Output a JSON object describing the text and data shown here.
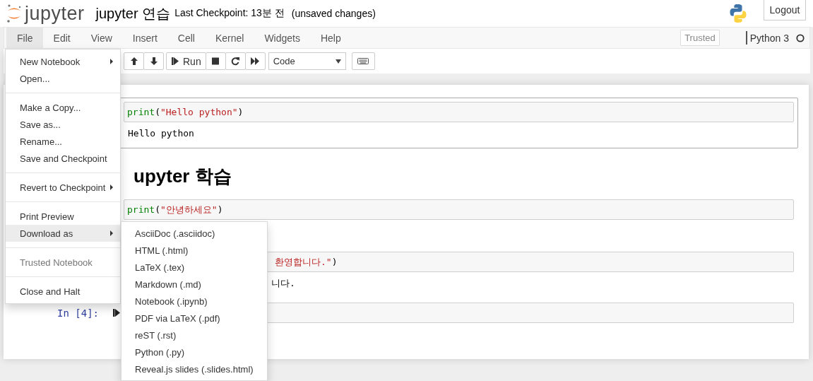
{
  "header": {
    "logo_text": "jupyter",
    "notebook_name": "jupyter 연습",
    "last_checkpoint": "Last Checkpoint: 13분 전",
    "autosave_status": "(unsaved changes)",
    "logout": "Logout"
  },
  "menubar": {
    "items": [
      {
        "label": "File",
        "selected": true
      },
      {
        "label": "Edit",
        "selected": false
      },
      {
        "label": "View",
        "selected": false
      },
      {
        "label": "Insert",
        "selected": false
      },
      {
        "label": "Cell",
        "selected": false
      },
      {
        "label": "Kernel",
        "selected": false
      },
      {
        "label": "Widgets",
        "selected": false
      },
      {
        "label": "Help",
        "selected": false
      }
    ],
    "trusted": "Trusted",
    "kernel": {
      "name": "Python 3",
      "busy": false
    }
  },
  "toolbar": {
    "run_label": "Run",
    "cell_type": "Code"
  },
  "notebook": {
    "cells": [
      {
        "kind": "code",
        "input": [
          {
            "color": "#008000",
            "text": "print"
          },
          {
            "text": "("
          },
          {
            "color": "#ba2121",
            "text": "\"Hello python\""
          },
          {
            "text": ")"
          }
        ],
        "output": "Hello python"
      },
      {
        "kind": "heading",
        "text": "upyter 학습"
      },
      {
        "kind": "code",
        "input": [
          {
            "color": "#008000",
            "text": "print"
          },
          {
            "text": "("
          },
          {
            "color": "#ba2121",
            "text": "\"안녕하세요\""
          },
          {
            "text": ")"
          }
        ]
      },
      {
        "kind": "code",
        "input": [
          {
            "color": "#ba2121",
            "text": "환영합니다.\""
          },
          {
            "text": ")"
          }
        ],
        "output": "니다."
      },
      {
        "kind": "code",
        "prompt": "In [4]:"
      }
    ]
  },
  "file_menu": {
    "items": [
      {
        "kind": "item",
        "label": "New Notebook",
        "submenu": true,
        "selected": false,
        "disabled": false
      },
      {
        "kind": "item",
        "label": "Open...",
        "submenu": false,
        "selected": false,
        "disabled": false
      },
      {
        "kind": "divider"
      },
      {
        "kind": "item",
        "label": "Make a Copy...",
        "submenu": false,
        "selected": false,
        "disabled": false
      },
      {
        "kind": "item",
        "label": "Save as...",
        "submenu": false,
        "selected": false,
        "disabled": false
      },
      {
        "kind": "item",
        "label": "Rename...",
        "submenu": false,
        "selected": false,
        "disabled": false
      },
      {
        "kind": "item",
        "label": "Save and Checkpoint",
        "submenu": false,
        "selected": false,
        "disabled": false
      },
      {
        "kind": "divider"
      },
      {
        "kind": "item",
        "label": "Revert to Checkpoint",
        "submenu": true,
        "selected": false,
        "disabled": false
      },
      {
        "kind": "divider"
      },
      {
        "kind": "item",
        "label": "Print Preview",
        "submenu": false,
        "selected": false,
        "disabled": false
      },
      {
        "kind": "item",
        "label": "Download as",
        "submenu": true,
        "selected": true,
        "disabled": false
      },
      {
        "kind": "divider"
      },
      {
        "kind": "item",
        "label": "Trusted Notebook",
        "submenu": false,
        "selected": false,
        "disabled": true
      },
      {
        "kind": "divider"
      },
      {
        "kind": "item",
        "label": "Close and Halt",
        "submenu": false,
        "selected": false,
        "disabled": false
      }
    ]
  },
  "download_menu": {
    "items": [
      "AsciiDoc (.asciidoc)",
      "HTML (.html)",
      "LaTeX (.tex)",
      "Markdown (.md)",
      "Notebook (.ipynb)",
      "PDF via LaTeX (.pdf)",
      "reST (.rst)",
      "Python (.py)",
      "Reveal.js slides (.slides.html)"
    ]
  }
}
